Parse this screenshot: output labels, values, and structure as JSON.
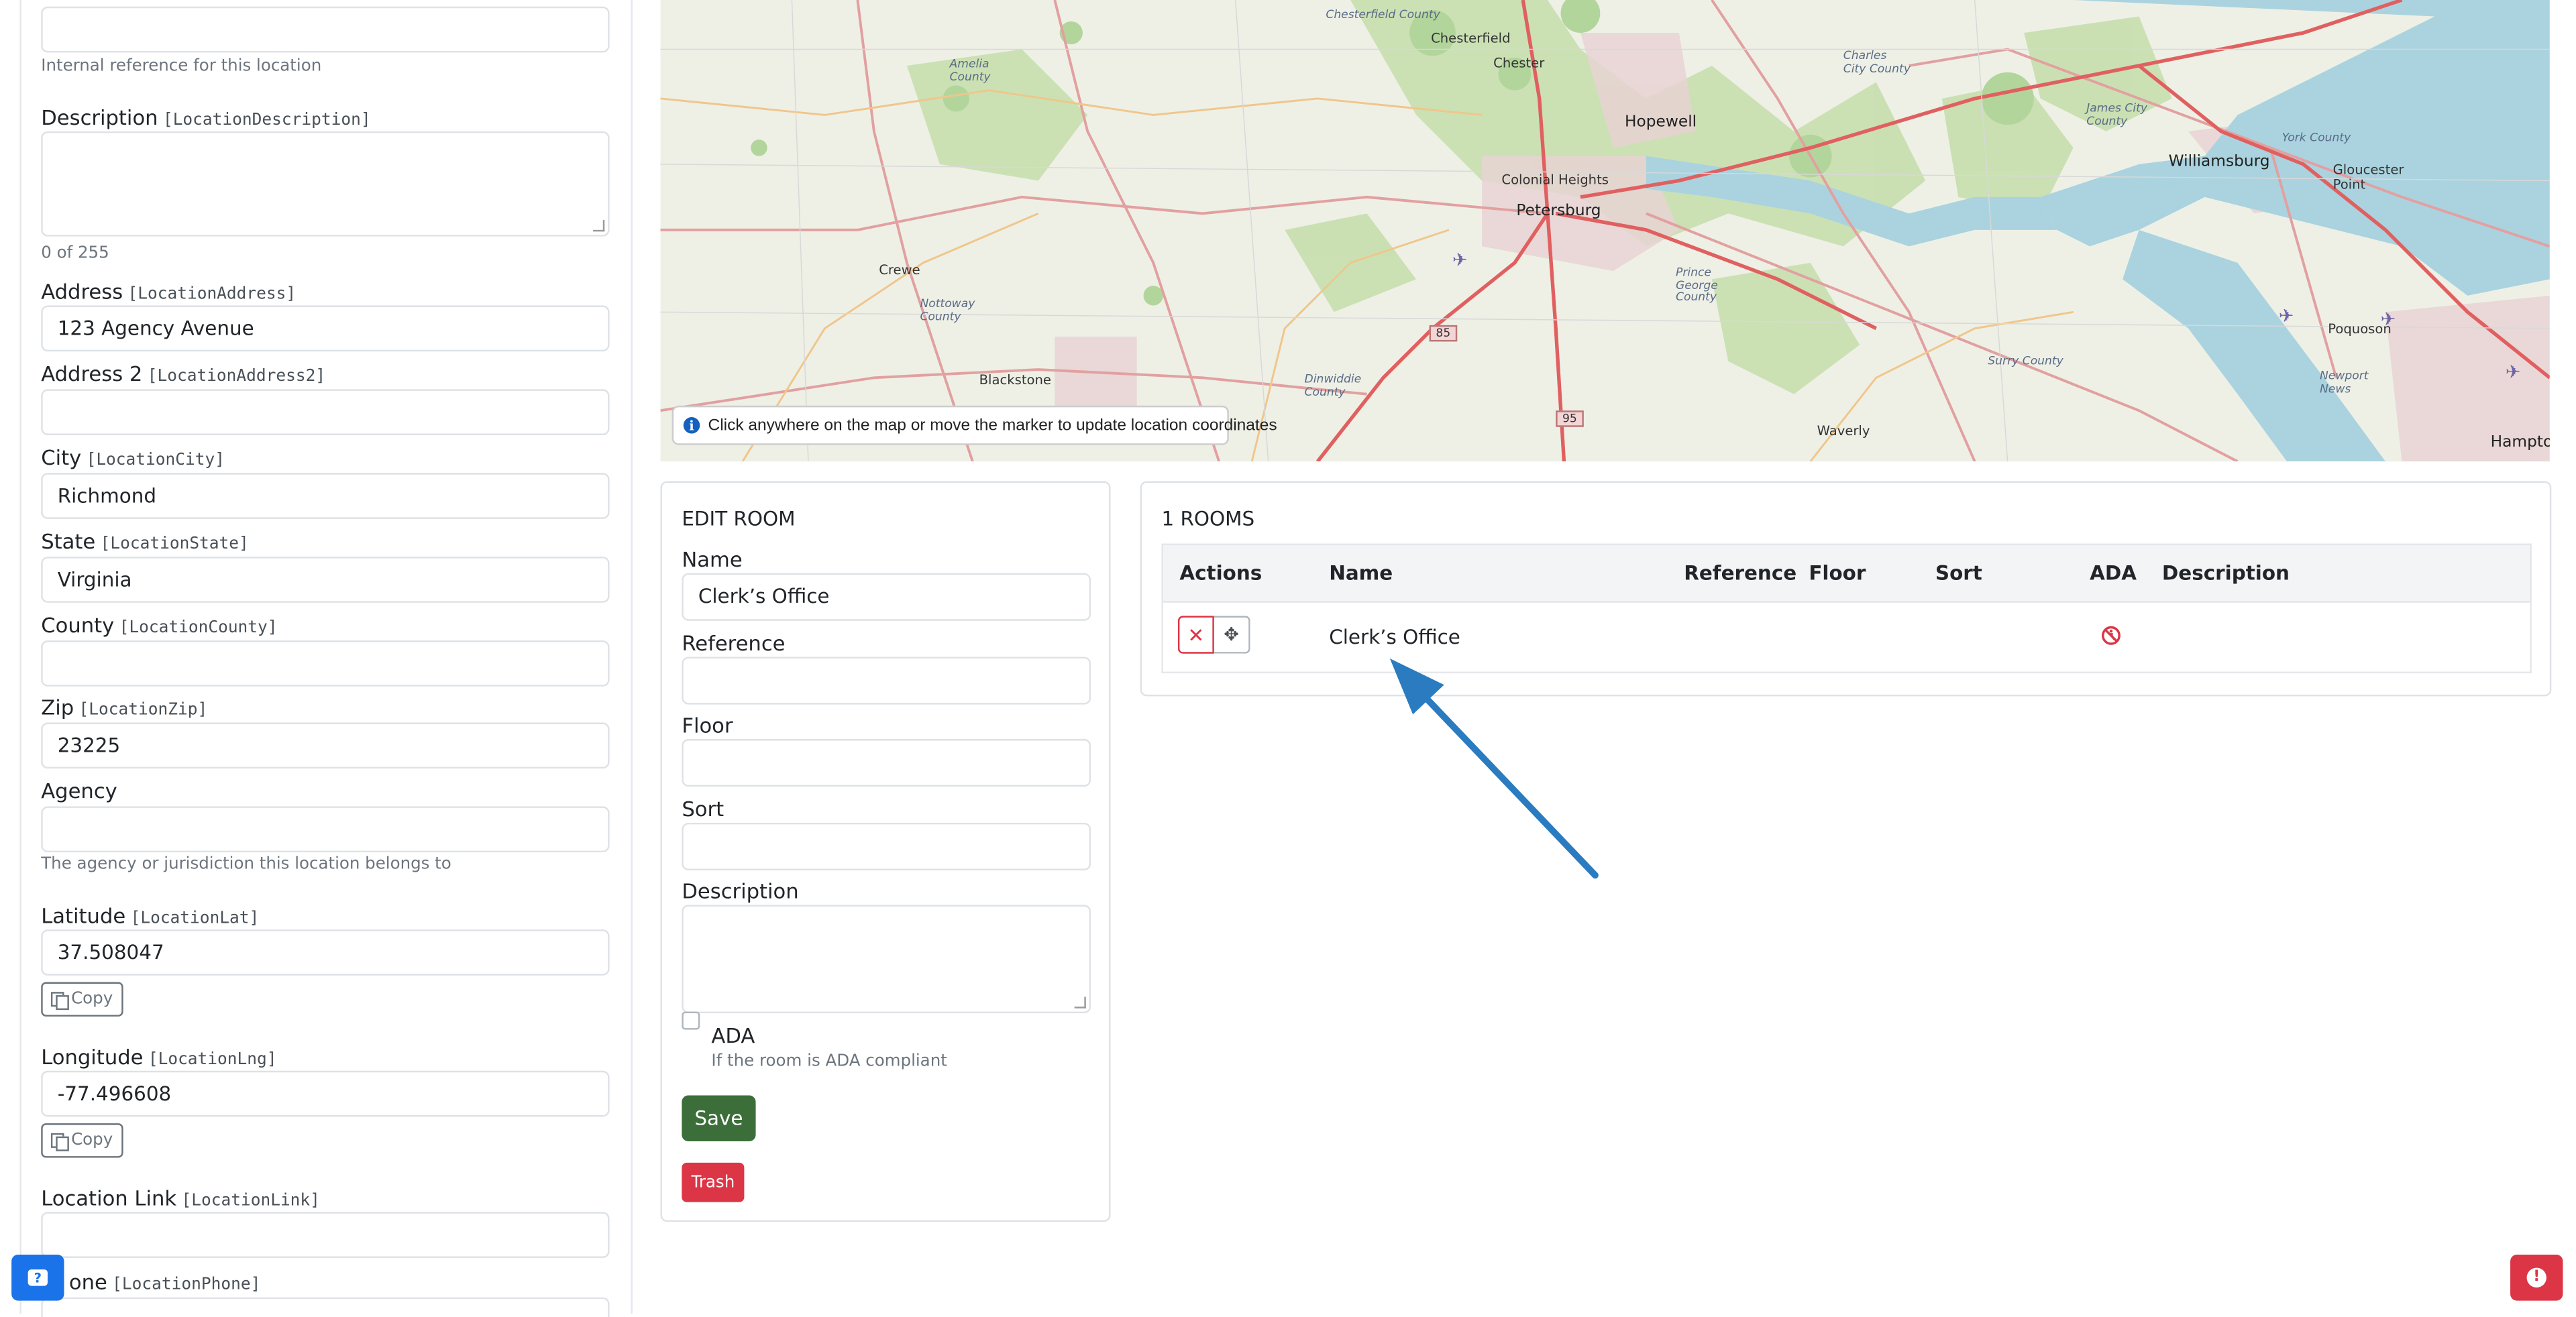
{
  "left_form": {
    "top_help": "Internal reference for this location",
    "description": {
      "label": "Description",
      "code": "[LocationDescription]",
      "counter": "0 of 255"
    },
    "address": {
      "label": "Address",
      "code": "[LocationAddress]",
      "value": "123 Agency Avenue"
    },
    "address2": {
      "label": "Address 2",
      "code": "[LocationAddress2]",
      "value": ""
    },
    "city": {
      "label": "City",
      "code": "[LocationCity]",
      "value": "Richmond"
    },
    "state": {
      "label": "State",
      "code": "[LocationState]",
      "value": "Virginia"
    },
    "county": {
      "label": "County",
      "code": "[LocationCounty]",
      "value": ""
    },
    "zip": {
      "label": "Zip",
      "code": "[LocationZip]",
      "value": "23225"
    },
    "agency": {
      "label": "Agency",
      "value": "",
      "help": "The agency or jurisdiction this location belongs to"
    },
    "latitude": {
      "label": "Latitude",
      "code": "[LocationLat]",
      "value": "37.508047",
      "copy_label": "Copy"
    },
    "longitude": {
      "label": "Longitude",
      "code": "[LocationLng]",
      "value": "-77.496608",
      "copy_label": "Copy"
    },
    "link": {
      "label": "Location Link",
      "code": "[LocationLink]",
      "value": ""
    },
    "phone": {
      "label": "one",
      "code": "[LocationPhone]"
    }
  },
  "map": {
    "hint": "Click anywhere on the map or move the marker to update location coordinates",
    "labels": {
      "chesterfield": "Chesterfield",
      "chester": "Chester",
      "hopewell": "Hopewell",
      "colonial_heights": "Colonial Heights",
      "petersburg": "Petersburg",
      "crewe": "Crewe",
      "blackstone": "Blackstone",
      "waverly": "Waverly",
      "williamsburg": "Williamsburg",
      "poquoson": "Poquoson",
      "gloucester_point": "Gloucester\nPoint",
      "hampton": "Hampto",
      "amelia_county": "Amelia\nCounty",
      "nottoway_county": "Nottoway\nCounty",
      "dinwiddie_county": "Dinwiddie\nCounty",
      "prince_george_county": "Prince\nGeorge\nCounty",
      "charles_city_county": "Charles\nCity County",
      "james_city_county": "James City\nCounty",
      "surry_county": "Surry County",
      "york_county": "York County",
      "newport_news": "Newport\nNews",
      "chesterfield_county": "Chesterfield\nCounty"
    },
    "shields": {
      "i85": "85",
      "i95": "95"
    }
  },
  "edit_room": {
    "title": "EDIT ROOM",
    "name_label": "Name",
    "name_value": "Clerk’s Office",
    "reference_label": "Reference",
    "floor_label": "Floor",
    "sort_label": "Sort",
    "description_label": "Description",
    "ada_label": "ADA",
    "ada_help": "If the room is ADA compliant",
    "ada_checked": false,
    "save_label": "Save",
    "trash_label": "Trash"
  },
  "rooms": {
    "title": "1 ROOMS",
    "columns": [
      "Actions",
      "Name",
      "Reference",
      "Floor",
      "Sort",
      "ADA",
      "Description"
    ],
    "rows": [
      {
        "name": "Clerk’s Office",
        "reference": "",
        "floor": "",
        "sort": "",
        "ada": "not-accessible-icon",
        "description": ""
      }
    ]
  },
  "colors": {
    "save": "#3c6e3a",
    "danger": "#dc3545",
    "arrow": "#2a7bbf",
    "fab_left": "#1a73e8"
  },
  "icons": [
    "copy-icon",
    "info-icon",
    "delete-icon",
    "move-icon",
    "not-accessible-icon",
    "chat-icon",
    "alert-icon"
  ]
}
